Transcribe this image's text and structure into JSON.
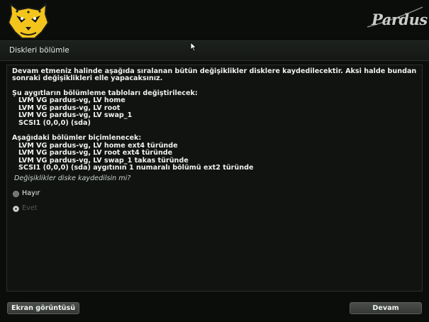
{
  "header": {
    "brand_text": "Pardus"
  },
  "titlebar": {
    "title": "Diskleri bölümle"
  },
  "message": {
    "intro_line1": "Devam etmeniz halinde aşağıda sıralanan bütün değişiklikler disklere kaydedilecektir. Aksi halde bundan",
    "intro_line2": "sonraki değişiklikleri elle yapacaksınız.",
    "partition_tables_heading": "Şu aygıtların bölümleme tabloları değiştirilecek:",
    "partition_tables": [
      "LVM VG pardus-vg, LV home",
      "LVM VG pardus-vg, LV root",
      "LVM VG pardus-vg, LV swap_1",
      "SCSI1 (0,0,0) (sda)"
    ],
    "format_heading": "Aşağıdaki bölümler biçimlenecek:",
    "format_items": [
      "LVM VG pardus-vg, LV home ext4 türünde",
      "LVM VG pardus-vg, LV root ext4 türünde",
      "LVM VG pardus-vg, LV swap_1 takas türünde",
      "SCSI1 (0,0,0) (sda) aygıtının 1 numaralı bölümü ext2 türünde"
    ],
    "question": "Değişiklikler diske kaydedilsin mi?"
  },
  "options": [
    {
      "label": "Hayır",
      "selected": false
    },
    {
      "label": "Evet",
      "selected": true
    }
  ],
  "buttons": {
    "screenshot": "Ekran görüntüsü",
    "continue": "Devam"
  }
}
